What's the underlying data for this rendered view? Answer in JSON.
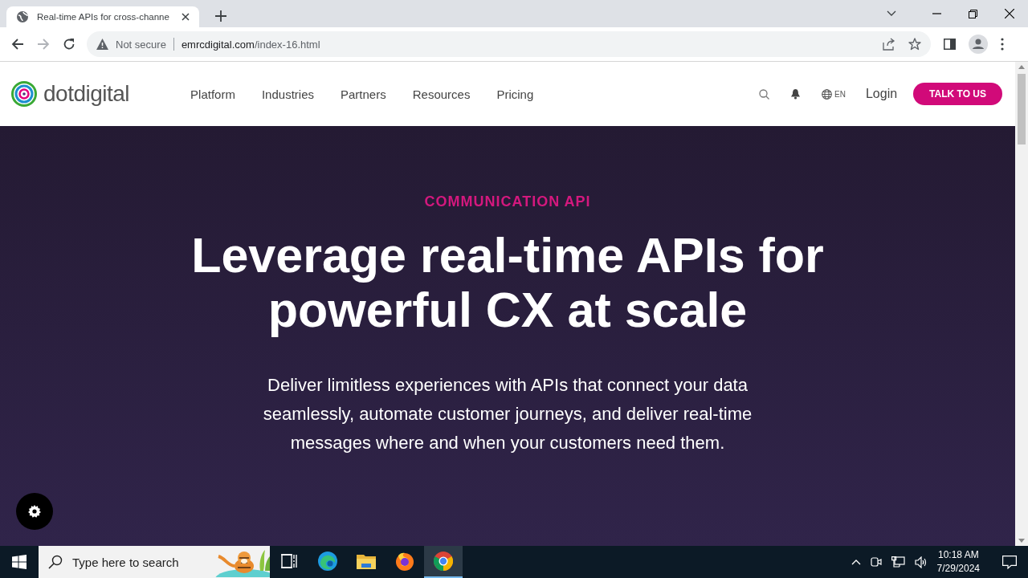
{
  "browser": {
    "tabs": [
      {
        "title": "Real-time APIs for cross-channe",
        "selected": true
      }
    ],
    "address": {
      "security": "Not secure",
      "host": "emrcdigital.com",
      "path": "/index-16.html"
    }
  },
  "site": {
    "logo": "dotdigital",
    "nav": [
      {
        "label": "Platform"
      },
      {
        "label": "Industries"
      },
      {
        "label": "Partners"
      },
      {
        "label": "Resources"
      },
      {
        "label": "Pricing"
      }
    ],
    "language": "EN",
    "login": "Login",
    "cta": "TALK TO US"
  },
  "hero": {
    "eyebrow": "COMMUNICATION API",
    "headline": "Leverage real-time APIs for powerful CX at scale",
    "description": "Deliver limitless experiences with APIs that connect your data seamlessly, automate customer journeys, and deliver real-time messages where and when your customers need them."
  },
  "taskbar": {
    "search_placeholder": "Type here to search",
    "apps": [
      {
        "kind": "taskview",
        "selected": false
      },
      {
        "kind": "edge",
        "selected": false
      },
      {
        "kind": "files",
        "selected": false
      },
      {
        "kind": "firefox",
        "selected": false
      },
      {
        "kind": "chrome",
        "selected": true
      }
    ],
    "time": "10:18 AM",
    "date": "7/29/2024"
  }
}
